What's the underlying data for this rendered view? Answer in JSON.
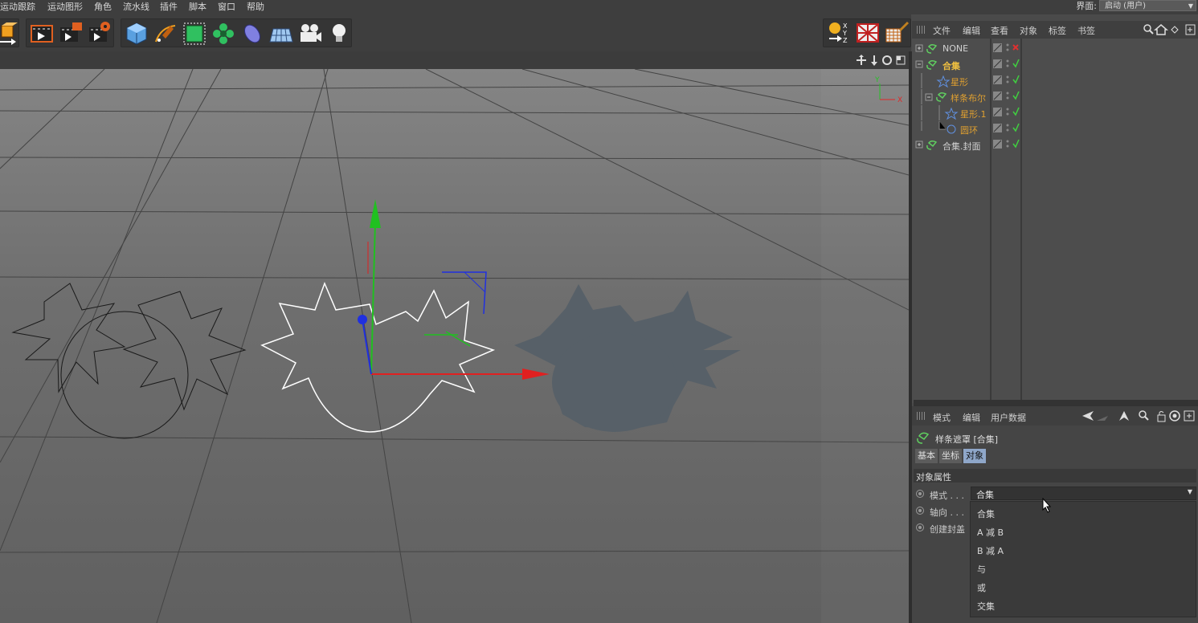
{
  "menubar": {
    "items": [
      "运动跟踪",
      "运动图形",
      "角色",
      "流水线",
      "插件",
      "脚本",
      "窗口",
      "帮助"
    ],
    "layout_label": "界面:",
    "layout_value": "启动 (用户)"
  },
  "toolbar": {
    "icons": [
      "make-editable-icon",
      "render-view-icon",
      "render-to-picture-viewer-icon",
      "render-settings-icon",
      "cube-icon",
      "pen-spline-icon",
      "subdivision-icon",
      "cloner-icon",
      "deformer-icon",
      "floor-icon",
      "camera-icon",
      "light-icon",
      "coordinate-system-icon",
      "texture-mode-icon",
      "paint-mode-icon"
    ]
  },
  "object_manager": {
    "menu": [
      "文件",
      "编辑",
      "查看",
      "对象",
      "标签",
      "书签"
    ],
    "objects": [
      {
        "name": "NONE",
        "color": "#d0d0d0",
        "status": "x"
      },
      {
        "name": "合集",
        "color": "#f0c040",
        "status": "check"
      },
      {
        "name": "星形",
        "color": "#e0a030",
        "status": "check"
      },
      {
        "name": "样条布尔",
        "color": "#e0a030",
        "status": "check"
      },
      {
        "name": "星形.1",
        "color": "#e0a030",
        "status": "check"
      },
      {
        "name": "圆环",
        "color": "#e0a030",
        "status": "check"
      },
      {
        "name": "合集.封面",
        "color": "#d0d0d0",
        "status": "check"
      }
    ]
  },
  "attribute_manager": {
    "menu": [
      "模式",
      "编辑",
      "用户数据"
    ],
    "object_title": "样条遮罩 [合集]",
    "tabs": [
      "基本",
      "坐标",
      "对象"
    ],
    "active_tab": "对象",
    "section_title": "对象属性",
    "params": [
      {
        "label": "模式 . . ."
      },
      {
        "label": "轴向 . . ."
      },
      {
        "label": "创建封盖"
      }
    ],
    "mode_value": "合集",
    "mode_options": [
      "合集",
      "A 减 B",
      "B 减 A",
      "与",
      "或",
      "交集"
    ]
  },
  "viewport": {
    "axis_labels": {
      "y": "Y",
      "x": "X"
    }
  },
  "colors": {
    "accent_active_tab": "#8fa7c9",
    "object_name_orange": "#e0a030",
    "check_green": "#40d040",
    "x_red": "#e03030",
    "axis_x": "#e02020",
    "axis_y": "#20c020",
    "axis_z": "#2030e0"
  }
}
